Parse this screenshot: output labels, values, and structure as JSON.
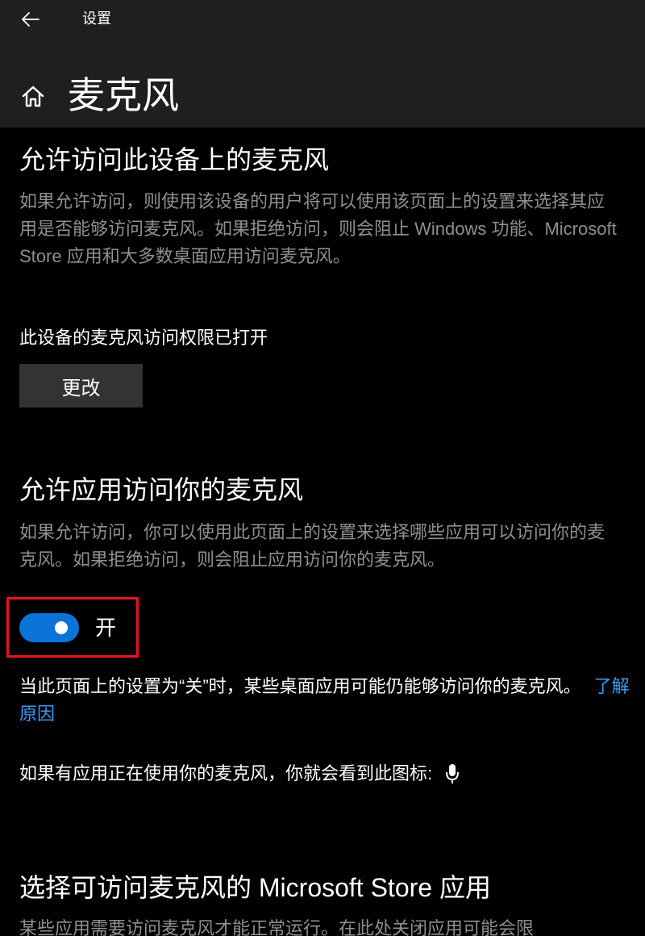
{
  "window": {
    "title": "设置"
  },
  "page": {
    "title": "麦克风"
  },
  "device_section": {
    "heading": "允许访问此设备上的麦克风",
    "description": "如果允许访问，则使用该设备的用户将可以使用该页面上的设置来选择其应用是否能够访问麦克风。如果拒绝访问，则会阻止 Windows 功能、Microsoft Store 应用和大多数桌面应用访问麦克风。",
    "status": "此设备的麦克风访问权限已打开",
    "change_button": "更改"
  },
  "apps_section": {
    "heading": "允许应用访问你的麦克风",
    "description": "如果允许访问，你可以使用此页面上的设置来选择哪些应用可以访问你的麦克风。如果拒绝访问，则会阻止应用访问你的麦克风。",
    "toggle_state": "开",
    "toggle_on": true,
    "note": "当此页面上的设置为“关”时，某些桌面应用可能仍能够访问你的麦克风。",
    "learn_more": "了解原因",
    "icon_note": "如果有应用正在使用你的麦克风，你就会看到此图标:"
  },
  "store_section": {
    "heading": "选择可访问麦克风的 Microsoft Store 应用",
    "description": "某些应用需要访问麦克风才能正常运行。在此处关闭应用可能会限"
  },
  "colors": {
    "accent": "#0a74d8",
    "link": "#3a9cf0",
    "highlight": "#e8141c",
    "header_bg": "#1f1f1f",
    "background": "#000000"
  },
  "icons": {
    "back": "back-arrow-icon",
    "home": "home-icon",
    "microphone": "microphone-icon"
  }
}
